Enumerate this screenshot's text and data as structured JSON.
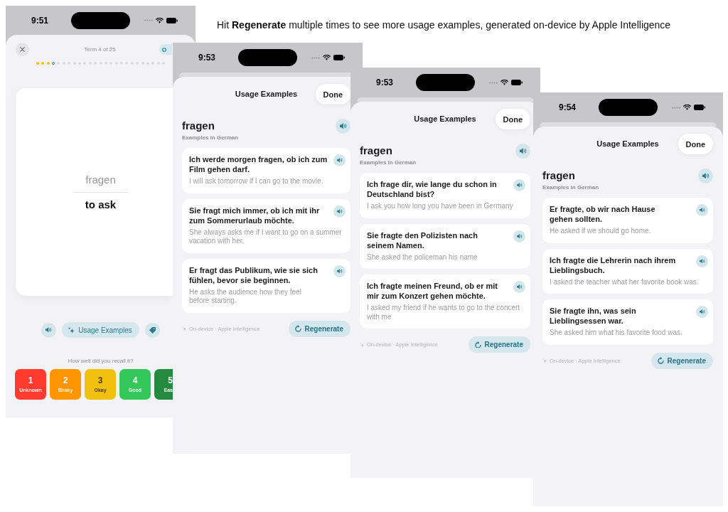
{
  "caption": "Hit **Regenerate** multiple times to see more usage examples, generated on-device by Apple Intelligence",
  "screens": [
    {
      "kind": "flashcard",
      "status_bar": {
        "time": "9:51"
      },
      "progress": {
        "label": "Term 4 of 25",
        "dots": [
          {
            "done": true,
            "current": false
          },
          {
            "done": true,
            "current": false
          },
          {
            "done": true,
            "current": false
          },
          {
            "done": false,
            "current": true
          },
          {
            "done": false,
            "current": false
          },
          {
            "done": false,
            "current": false
          },
          {
            "done": false,
            "current": false
          },
          {
            "done": false,
            "current": false
          },
          {
            "done": false,
            "current": false
          },
          {
            "done": false,
            "current": false
          },
          {
            "done": false,
            "current": false
          },
          {
            "done": false,
            "current": false
          },
          {
            "done": false,
            "current": false
          },
          {
            "done": false,
            "current": false
          },
          {
            "done": false,
            "current": false
          },
          {
            "done": false,
            "current": false
          },
          {
            "done": false,
            "current": false
          },
          {
            "done": false,
            "current": false
          },
          {
            "done": false,
            "current": false
          },
          {
            "done": false,
            "current": false
          },
          {
            "done": false,
            "current": false
          },
          {
            "done": false,
            "current": false
          },
          {
            "done": false,
            "current": false
          },
          {
            "done": false,
            "current": false
          },
          {
            "done": false,
            "current": false
          }
        ]
      },
      "card": {
        "term": "fragen",
        "translation": "to ask"
      },
      "actions": [
        {
          "kind": "speak"
        },
        {
          "kind": "examples",
          "label": "Usage Examples"
        },
        {
          "kind": "tag"
        }
      ],
      "recall": {
        "prompt": "How well did you recall it?",
        "options": [
          {
            "number": "1",
            "label": "Unknown",
            "color": "#ff3b30"
          },
          {
            "number": "2",
            "label": "Shaky",
            "color": "#ff9500"
          },
          {
            "number": "3",
            "label": "Okay",
            "color": "#f2c10f"
          },
          {
            "number": "4",
            "label": "Good",
            "color": "#34c759"
          },
          {
            "number": "5",
            "label": "Eas",
            "color": "#248a3d"
          }
        ]
      }
    },
    {
      "kind": "examples",
      "status_bar": {
        "time": "9:53"
      },
      "title": "Usage Examples",
      "done_button": "Done",
      "word": "fragen",
      "subtitle": "Examples in German",
      "examples": [
        {
          "sentence": "Ich werde morgen fragen, ob ich zum Film gehen darf.",
          "translation": "I will ask tomorrow if I can go to the movie."
        },
        {
          "sentence": "Sie fragt mich immer, ob ich mit ihr zum Sommerurlaub möchte.",
          "translation": "She always asks me if I want to go on a summer vacation with her."
        },
        {
          "sentence": "Er fragt das Publikum, wie sie sich fühlen, bevor sie beginnen.",
          "translation": "He asks the audience how they feel before starting."
        }
      ],
      "footer_note": "On-device · Apple Intelligence",
      "regenerate_button": "Regenerate"
    },
    {
      "kind": "examples",
      "status_bar": {
        "time": "9:53"
      },
      "title": "Usage Examples",
      "done_button": "Done",
      "word": "fragen",
      "subtitle": "Examples in German",
      "examples": [
        {
          "sentence": "Ich frage dir, wie lange du schon in Deutschland bist?",
          "translation": "I ask you how long you have been in Germany"
        },
        {
          "sentence": "Sie fragte den Polizisten nach seinem Namen.",
          "translation": "She asked the policeman his name"
        },
        {
          "sentence": "Ich fragte meinen Freund, ob er mit mir zum Konzert gehen möchte.",
          "translation": "I asked my friend if he wants to go to the concert with me"
        }
      ],
      "footer_note": "On-device · Apple Intelligence",
      "regenerate_button": "Regenerate"
    },
    {
      "kind": "examples",
      "status_bar": {
        "time": "9:54"
      },
      "title": "Usage Examples",
      "done_button": "Done",
      "word": "fragen",
      "subtitle": "Examples in German",
      "examples": [
        {
          "sentence": "Er fragte, ob wir nach Hause gehen sollten.",
          "translation": "He asked if we should go home."
        },
        {
          "sentence": "Ich fragte die Lehrerin nach ihrem Lieblingsbuch.",
          "translation": "I asked the teacher what her favorite book was."
        },
        {
          "sentence": "Sie fragte ihn, was sein Lieblingsessen war.",
          "translation": "She asked him what his favorite food was."
        }
      ],
      "footer_note": "On-device · Apple Intelligence",
      "regenerate_button": "Regenerate"
    }
  ]
}
